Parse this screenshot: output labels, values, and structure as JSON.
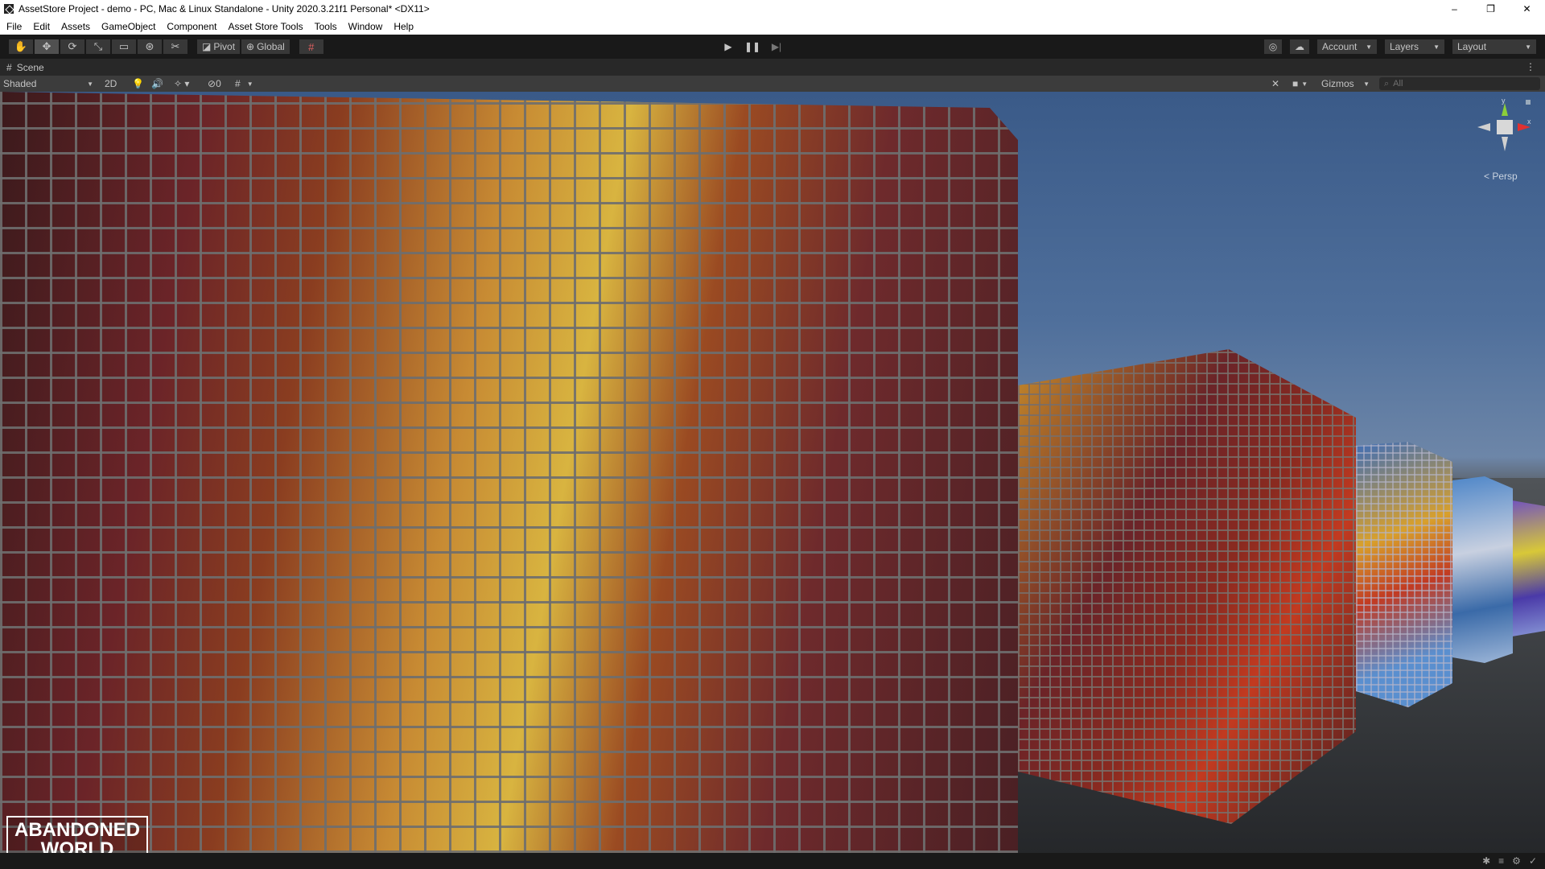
{
  "window": {
    "title": "AssetStore Project - demo - PC, Mac & Linux Standalone - Unity 2020.3.21f1 Personal* <DX11>",
    "controls": [
      "–",
      "❐",
      "✕"
    ]
  },
  "menu": [
    "File",
    "Edit",
    "Assets",
    "GameObject",
    "Component",
    "Asset Store Tools",
    "Tools",
    "Window",
    "Help"
  ],
  "toolbar": {
    "tools": [
      "hand-tool-icon",
      "move-tool-icon",
      "rotate-tool-icon",
      "scale-tool-icon",
      "rect-tool-icon",
      "transform-tool-icon",
      "custom-tool-icon"
    ],
    "pivot_label": "Pivot",
    "global_label": "Global",
    "account_label": "Account",
    "layers_label": "Layers",
    "layout_label": "Layout"
  },
  "scene_tab": {
    "label": "Scene"
  },
  "scene_toolbar": {
    "shading_mode": "Shaded",
    "mode_2d": "2D",
    "hidden_count": "0",
    "gizmos_label": "Gizmos",
    "search_placeholder": "All"
  },
  "viewport": {
    "gizmo": {
      "y_label": "y",
      "x_label": "x",
      "projection_label": "< Persp"
    },
    "logo_line1": "ABANDONED",
    "logo_line2": "WORLD"
  }
}
